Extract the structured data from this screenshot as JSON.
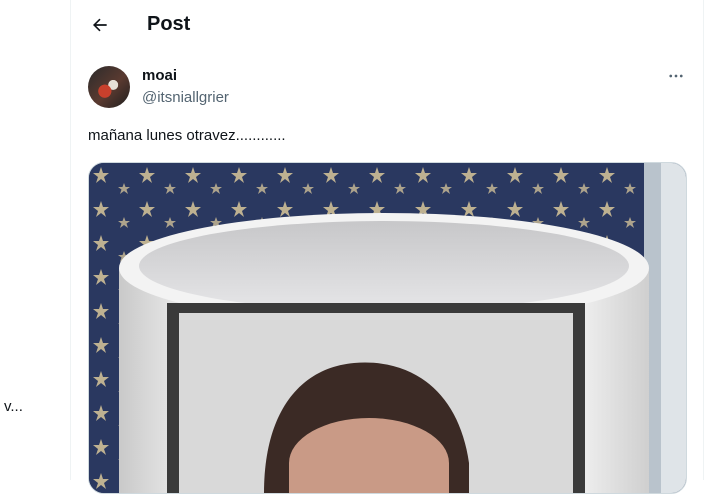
{
  "left_fragment": "v...",
  "header": {
    "title": "Post"
  },
  "post": {
    "author_name": "moai",
    "author_handle": "@itsniallgrier",
    "text": "mañana lunes otravez............"
  },
  "icons": {
    "back": "arrow-left-icon",
    "more": "more-horizontal-icon"
  },
  "colors": {
    "text": "#0f1419",
    "secondary": "#536471",
    "border": "#eff3f4"
  }
}
